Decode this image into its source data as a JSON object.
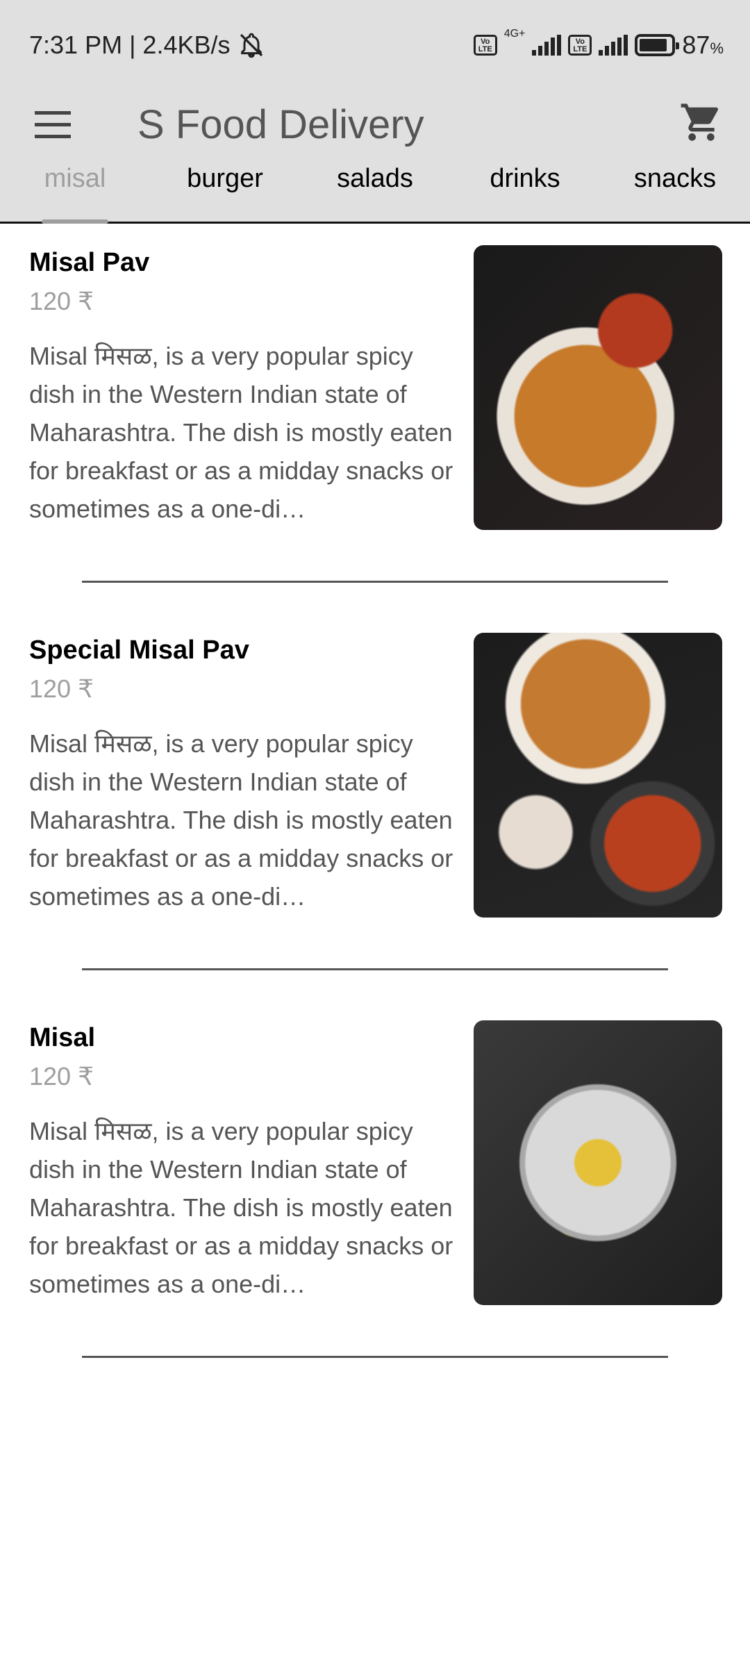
{
  "status_bar": {
    "time_speed": "7:31 PM | 2.4KB/s",
    "mute_icon": "bell-off-icon",
    "network_type": "4G+",
    "volte_label": "Vo LTE",
    "battery": "87",
    "battery_unit": "%",
    "battery_level": 0.87
  },
  "toolbar": {
    "title": "S Food Delivery",
    "menu_icon": "hamburger-menu-icon",
    "cart_icon": "shopping-cart-icon"
  },
  "tabs": [
    {
      "label": "misal",
      "active": true
    },
    {
      "label": "burger",
      "active": false
    },
    {
      "label": "salads",
      "active": false
    },
    {
      "label": "drinks",
      "active": false
    },
    {
      "label": "snacks",
      "active": false
    }
  ],
  "items": [
    {
      "title": "Misal Pav",
      "price": "120 ₹",
      "description": "Misal मिसळ, is a very popular spicy dish in the Western Indian state of Maharashtra. The dish is mostly eaten for breakfast or as a midday snacks or sometimes as a one-di…"
    },
    {
      "title": "Special Misal Pav",
      "price": "120 ₹",
      "description": "Misal मिसळ, is a very popular spicy dish in the Western Indian state of Maharashtra. The dish is mostly eaten for breakfast or as a midday snacks or sometimes as a one-di…"
    },
    {
      "title": "Misal",
      "price": "120 ₹",
      "description": "Misal मिसळ, is a very popular spicy dish in the Western Indian state of Maharashtra. The dish is mostly eaten for breakfast or as a midday snacks or sometimes as a one-di…"
    }
  ],
  "colors": {
    "header_bg": "#e0e0e0",
    "inactive_tab": "#9e9e9e",
    "price": "#9e9e9e",
    "description": "#555555"
  }
}
